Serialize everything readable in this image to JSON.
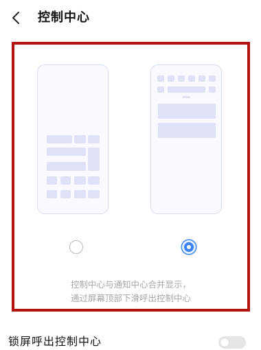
{
  "header": {
    "back_icon": "chevron-left-icon",
    "title": "控制中心"
  },
  "options": [
    {
      "id": "separate",
      "selected": false
    },
    {
      "id": "merged",
      "selected": true
    }
  ],
  "description": {
    "line1": "控制中心与通知中心合并显示，",
    "line2": "通过屏幕顶部下滑呼出控制中心"
  },
  "lock_screen": {
    "label": "锁屏呼出控制中心",
    "enabled": false
  },
  "colors": {
    "highlight_border": "#b3120f",
    "accent": "#3b82f6",
    "illustration": "#dfe2f6"
  }
}
